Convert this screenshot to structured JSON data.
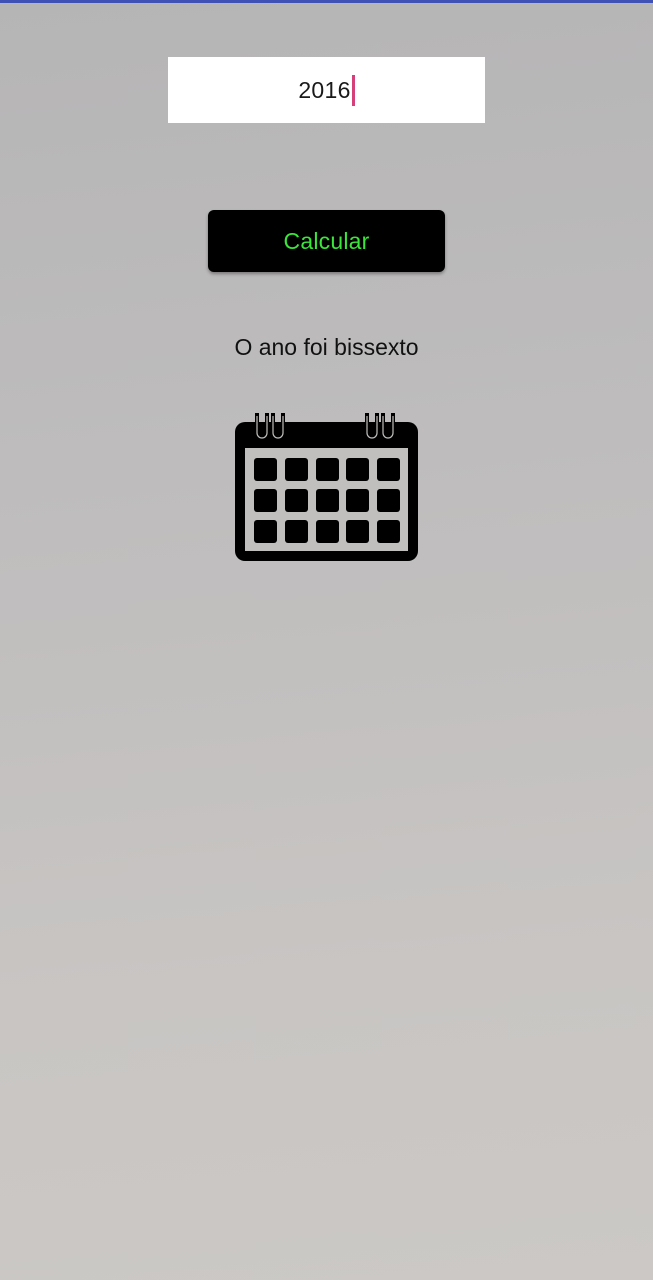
{
  "colors": {
    "top_bar": "#3f51b5",
    "cursor": "#d6407a",
    "button_bg": "#000000",
    "button_text": "#39e639"
  },
  "year_input": {
    "value": "2016"
  },
  "calculate_button": {
    "label": "Calcular"
  },
  "result": {
    "text": "O ano foi bissexto"
  },
  "image": {
    "icon": "calendar-icon"
  }
}
